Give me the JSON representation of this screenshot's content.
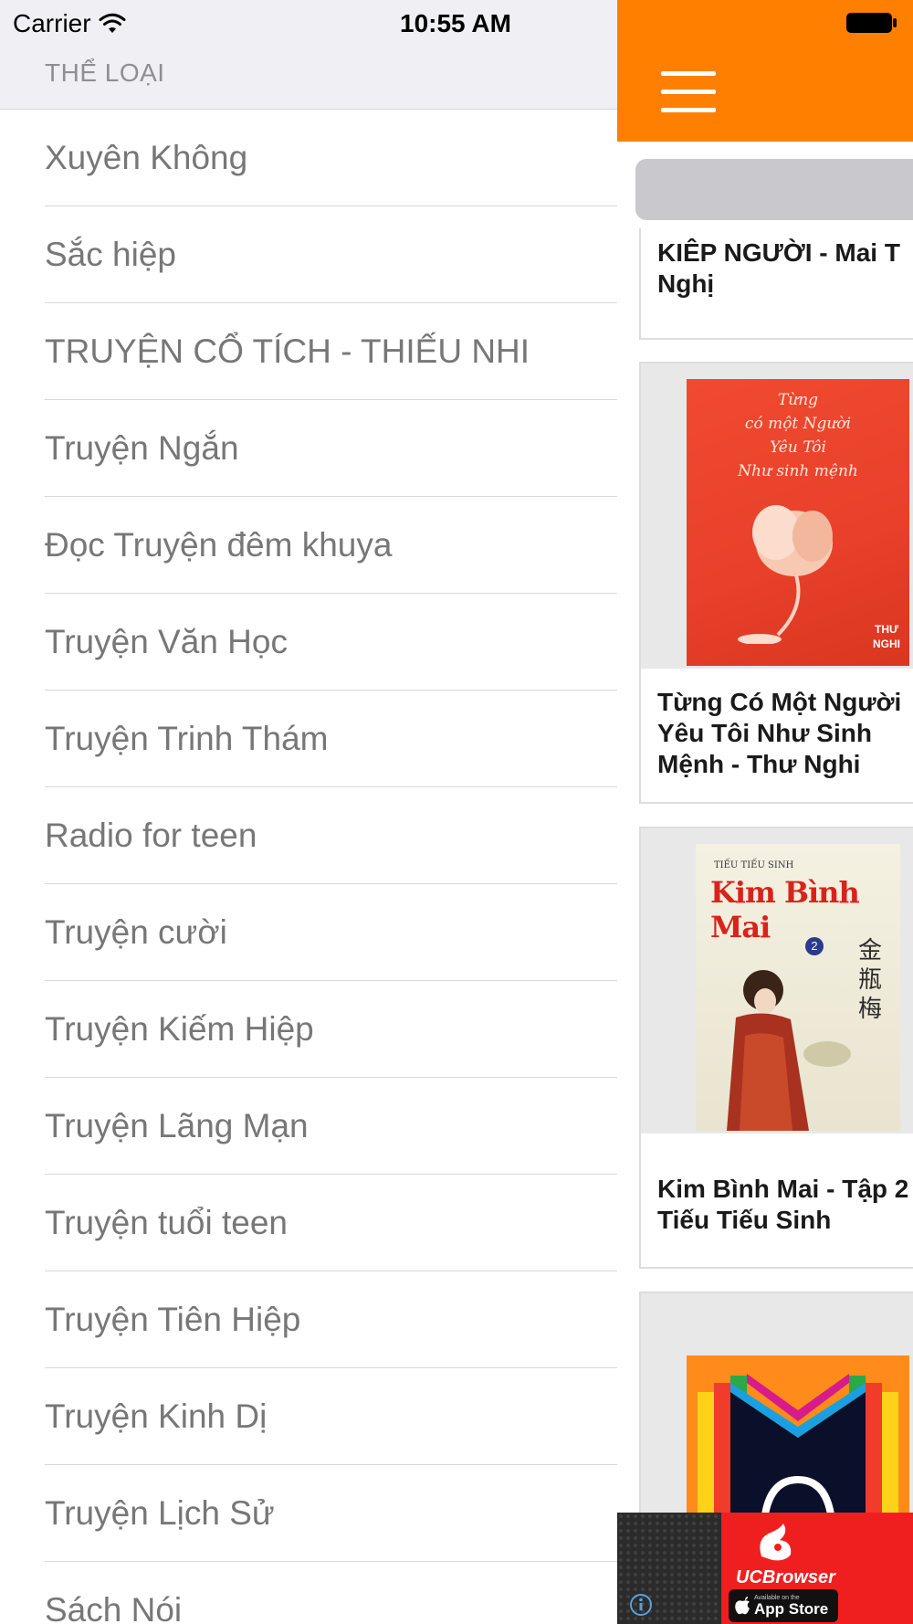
{
  "status_bar": {
    "carrier": "Carrier",
    "time": "10:55 AM"
  },
  "drawer": {
    "section_title": "THỂ LOẠI",
    "items": [
      {
        "label": "Xuyên Không"
      },
      {
        "label": "Sắc hiệp"
      },
      {
        "label": "TRUYỆN CỔ TÍCH - THIẾU NHI"
      },
      {
        "label": "Truyện Ngắn"
      },
      {
        "label": "Đọc Truyện đêm khuya"
      },
      {
        "label": "Truyện Văn Học"
      },
      {
        "label": "Truyện Trinh Thám"
      },
      {
        "label": "Radio for teen"
      },
      {
        "label": "Truyện cười"
      },
      {
        "label": "Truyện Kiếm Hiệp"
      },
      {
        "label": "Truyện Lãng Mạn"
      },
      {
        "label": "Truyện tuổi teen"
      },
      {
        "label": "Truyện Tiên Hiệp"
      },
      {
        "label": "Truyện Kinh Dị"
      },
      {
        "label": "Truyện Lịch Sử"
      },
      {
        "label": "Sách Nói"
      }
    ]
  },
  "main": {
    "navbar_color": "#ff8000",
    "cards": [
      {
        "title": "KIÊP NGƯỜI - Mai T\nNghị"
      },
      {
        "title": "Từng Có Một Người\nYêu Tôi Như Sinh\nMệnh -  Thư Nghi",
        "cover_text": [
          "Từng",
          "có một Người",
          "Yêu Tôi",
          "Như sinh mệnh"
        ],
        "cover_author": "THƯ\nNGHI"
      },
      {
        "title": "Kim Bình Mai - Tập 2\nTiếu Tiếu Sinh",
        "cover_top": "TIẾU TIẾU SINH",
        "cover_title": "Kim Bình Mai",
        "cover_vol": "2",
        "cover_chinese": "金瓶梅"
      },
      {
        "title": ""
      }
    ]
  },
  "ad": {
    "brand": "UCBrowser",
    "store_small": "Available on the",
    "store_big": "App Store"
  }
}
